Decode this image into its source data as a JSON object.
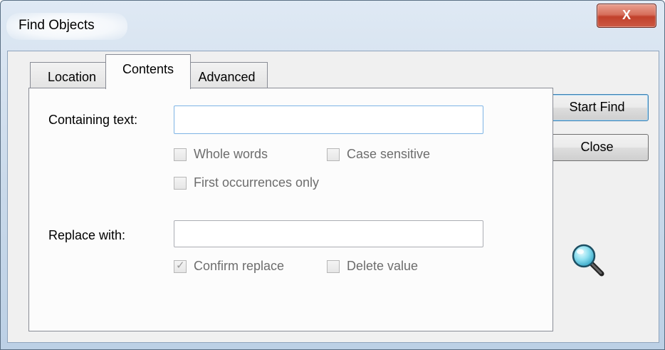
{
  "window": {
    "title": "Find Objects",
    "close_glyph": "X"
  },
  "tabs": [
    {
      "label": "Location"
    },
    {
      "label": "Contents"
    },
    {
      "label": "Advanced"
    }
  ],
  "active_tab": "Contents",
  "contents": {
    "containing_label": "Containing text:",
    "containing_value": "",
    "whole_words": {
      "label": "Whole words",
      "checked": false,
      "enabled": false
    },
    "case_sensitive": {
      "label": "Case sensitive",
      "checked": false,
      "enabled": false
    },
    "first_occurrences": {
      "label": "First occurrences only",
      "checked": false,
      "enabled": false
    },
    "replace_label": "Replace with:",
    "replace_value": "",
    "confirm_replace": {
      "label": "Confirm replace",
      "checked": true,
      "enabled": false
    },
    "delete_value": {
      "label": "Delete value",
      "checked": false,
      "enabled": false
    }
  },
  "buttons": {
    "start_find": "Start Find",
    "close": "Close"
  },
  "icons": {
    "find": "magnifier-icon",
    "close": "close-icon",
    "check": "checkmark-icon"
  },
  "colors": {
    "accent": "#3c7fb1",
    "close_button": "#c1402b",
    "focus_border": "#7eb4e5"
  }
}
